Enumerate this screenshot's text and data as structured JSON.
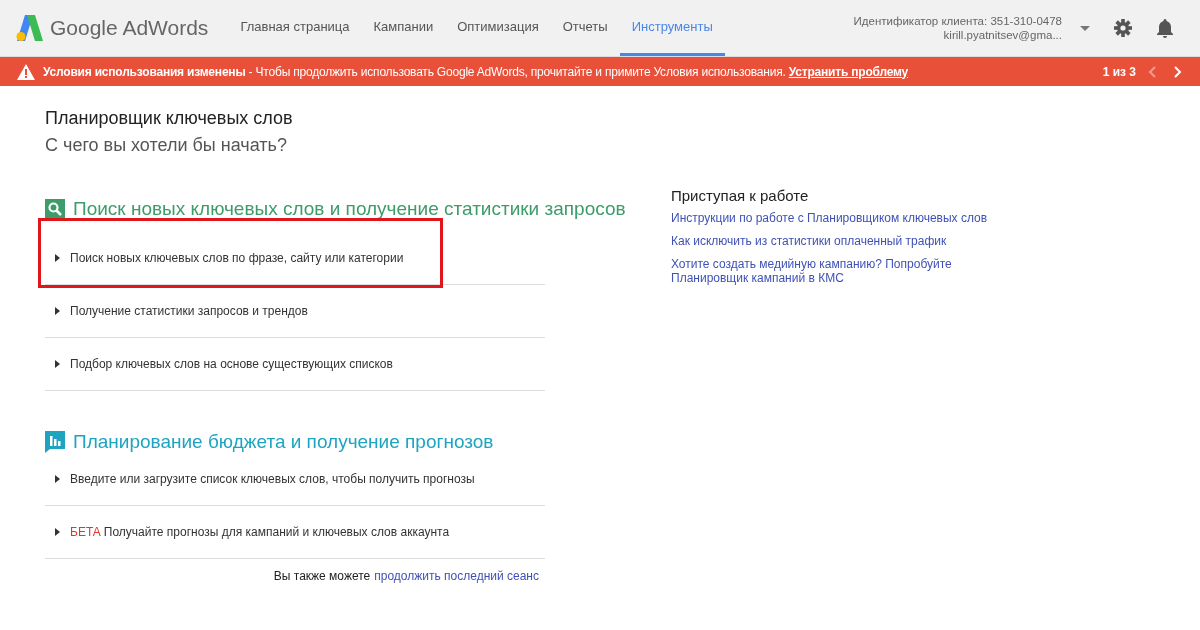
{
  "header": {
    "logo_text": "Google AdWords",
    "tabs": [
      {
        "label": "Главная страница",
        "selected": false
      },
      {
        "label": "Кампании",
        "selected": false
      },
      {
        "label": "Оптимизация",
        "selected": false
      },
      {
        "label": "Отчеты",
        "selected": false
      },
      {
        "label": "Инструменты",
        "selected": true
      }
    ],
    "account": {
      "client_id": "Идентификатор клиента: 351-310-0478",
      "email": "kirill.pyatnitsev@gma..."
    }
  },
  "banner": {
    "message": "**Условия использования изменены** - Чтобы продолжить использовать Google AdWords, прочитайте и примите Условия использования.",
    "link": "Устранить проблему",
    "counter": "1 из 3",
    "prev_disabled": true,
    "next_disabled": false
  },
  "page": {
    "title": "Планировщик ключевых слов",
    "subtitle": "С чего вы хотели бы начать?",
    "sections": [
      {
        "kind": "search",
        "heading": "Поиск новых ключевых слов и получение статистики запросов",
        "color": "#3c9c6a",
        "options": [
          {
            "text": "Поиск новых ключевых слов по фразе, сайту или категории",
            "highlighted": true
          },
          {
            "text": "Получение статистики запросов и трендов",
            "highlighted": false
          },
          {
            "text": "Подбор ключевых слов на основе существующих списков",
            "highlighted": false
          }
        ]
      },
      {
        "kind": "chart",
        "heading": "Планирование бюджета и получение прогнозов",
        "color": "#1ea4c0",
        "options": [
          {
            "text": "Введите или загрузите список ключевых слов, чтобы получить прогнозы",
            "highlighted": false
          },
          {
            "badge": "БЕТА",
            "text": "Получайте прогнозы для кампаний и ключевых слов аккаунта",
            "highlighted": false
          }
        ]
      }
    ],
    "resume": {
      "text": "Вы также можете",
      "link": "продолжить последний сеанс"
    }
  },
  "sidebar": {
    "heading": "Приступая к работе",
    "links": [
      "Инструкции по работе с Планировщиком ключевых слов",
      "Как исключить из статистики оплаченный трафик",
      "Хотите создать медийную кампанию? Попробуйте Планировщик кампаний в КМС"
    ]
  }
}
